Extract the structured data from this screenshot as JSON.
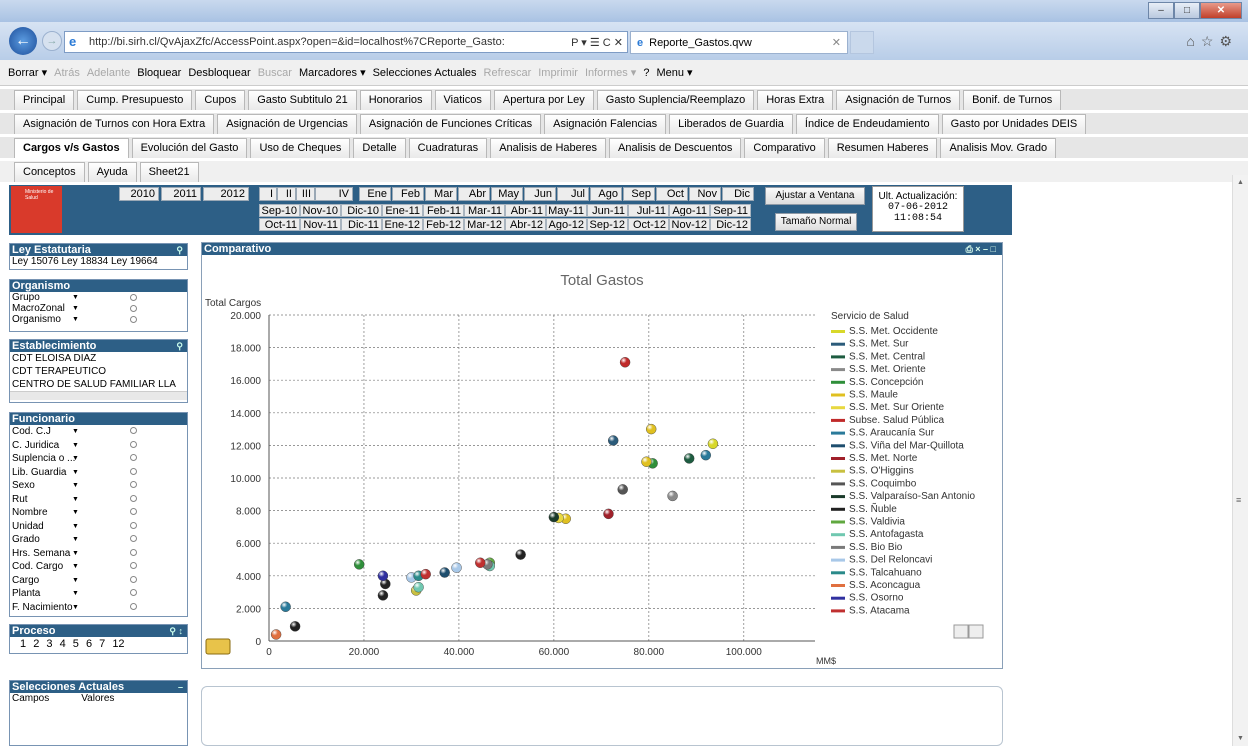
{
  "browser": {
    "url": "http://bi.sirh.cl/QvAjaxZfc/AccessPoint.aspx?open=&id=localhost%7CReporte_Gasto:",
    "url_controls": "Ρ ▾ ☰ C ✕",
    "tab_title": "Reporte_Gastos.qvw",
    "tab_close": "✕"
  },
  "qv_toolbar": [
    "Borrar ▾",
    "Atrás",
    "Adelante",
    "Bloquear",
    "Desbloquear",
    "Buscar",
    "Marcadores ▾",
    "Selecciones Actuales",
    "Refrescar",
    "Imprimir",
    "Informes ▾",
    "?",
    "Menu ▾"
  ],
  "tabs_row1": [
    "Principal",
    "Cump. Presupuesto",
    "Cupos",
    "Gasto Subtitulo 21",
    "Honorarios",
    "Viaticos",
    "Apertura por Ley",
    "Gasto Suplencia/Reemplazo",
    "Horas Extra",
    "Asignación de Turnos",
    "Bonif. de Turnos"
  ],
  "tabs_row2": [
    "Asignación de Turnos con Hora Extra",
    "Asignación de Urgencias",
    "Asignación de Funciones Críticas",
    "Asignación Falencias",
    "Liberados de Guardia",
    "Índice de Endeudamiento",
    "Gasto por Unidades DEIS"
  ],
  "tabs_row3": [
    "Cargos v/s Gastos",
    "Evolución del Gasto",
    "Uso de Cheques",
    "Detalle",
    "Cuadraturas",
    "Analisis de Haberes",
    "Analisis de Descuentos",
    "Comparativo",
    "Resumen Haberes",
    "Analisis Mov. Grado"
  ],
  "tabs_row4": [
    "Conceptos",
    "Ayuda",
    "Sheet21"
  ],
  "header": {
    "logo_text": "Ministerio de Salud",
    "years": [
      "2010",
      "2011",
      "2012"
    ],
    "quarters": [
      "I",
      "II",
      "III",
      "IV"
    ],
    "months": [
      "Ene",
      "Feb",
      "Mar",
      "Abr",
      "May",
      "Jun",
      "Jul",
      "Ago",
      "Sep",
      "Oct",
      "Nov",
      "Dic"
    ],
    "ym_row1": [
      "Sep-10",
      "Nov-10",
      "Dic-10",
      "Ene-11",
      "Feb-11",
      "Mar-11",
      "Abr-11",
      "May-11",
      "Jun-11",
      "Jul-11",
      "Ago-11",
      "Sep-11"
    ],
    "ym_row2": [
      "Oct-11",
      "Nov-11",
      "Dic-11",
      "Ene-12",
      "Feb-12",
      "Mar-12",
      "Abr-12",
      "Ago-12",
      "Sep-12",
      "Oct-12",
      "Nov-12",
      "Dic-12"
    ],
    "btn_ajustar": "Ajustar a Ventana",
    "btn_normal": "Tamaño Normal",
    "ult_label": "Ult. Actualización:",
    "ult_date": "07-06-2012",
    "ult_time": "11:08:54"
  },
  "ley": {
    "title": "Ley Estatutaria",
    "values": [
      "Ley 15076",
      "Ley 18834",
      "Ley 19664"
    ]
  },
  "organismo": {
    "title": "Organismo",
    "items": [
      "Grupo",
      "MacroZonal",
      "Organismo"
    ]
  },
  "establecimiento": {
    "title": "Establecimiento",
    "items": [
      "CDT ELOISA DIAZ",
      "CDT TERAPEUTICO",
      "CENTRO DE SALUD FAMILIAR LLA"
    ]
  },
  "funcionario": {
    "title": "Funcionario",
    "items": [
      "Cod. C.J",
      "C. Juridica",
      "Suplencia o ...",
      "Lib. Guardia",
      "Sexo",
      "Rut",
      "Nombre",
      "Unidad",
      "Grado",
      "Hrs. Semana",
      "Cod. Cargo",
      "Cargo",
      "Planta",
      "F. Nacimiento"
    ]
  },
  "proceso": {
    "title": "Proceso",
    "values": [
      "1",
      "2",
      "3",
      "4",
      "5",
      "6",
      "7",
      "12"
    ]
  },
  "selecciones": {
    "title": "Selecciones Actuales",
    "col1": "Campos",
    "col2": "Valores"
  },
  "chart_panel_title": "Comparativo",
  "chart_data": {
    "type": "scatter",
    "title": "Total Gastos",
    "ylabel": "Total Cargos",
    "xlabel": "MM$",
    "xlim": [
      0,
      115000
    ],
    "ylim": [
      0,
      20000
    ],
    "xticks": [
      "0",
      "20.000",
      "40.000",
      "60.000",
      "80.000",
      "100.000"
    ],
    "xtick_values": [
      0,
      20000,
      40000,
      60000,
      80000,
      100000
    ],
    "yticks": [
      "0",
      "2.000",
      "4.000",
      "6.000",
      "8.000",
      "10.000",
      "12.000",
      "14.000",
      "16.000",
      "18.000",
      "20.000"
    ],
    "ytick_values": [
      0,
      2000,
      4000,
      6000,
      8000,
      10000,
      12000,
      14000,
      16000,
      18000,
      20000
    ],
    "legend_title": "Servicio de Salud",
    "legend_position": "right",
    "series": [
      {
        "name": "S.S. Met. Occidente",
        "color": "#d8d82a",
        "points": [
          [
            93500,
            12100
          ]
        ]
      },
      {
        "name": "S.S. Met. Sur",
        "color": "#2b5b7a",
        "points": [
          [
            72500,
            12300
          ]
        ]
      },
      {
        "name": "S.S. Met. Central",
        "color": "#1d5c40",
        "points": [
          [
            88500,
            11200
          ]
        ]
      },
      {
        "name": "S.S. Met. Oriente",
        "color": "#8a8a8a",
        "points": [
          [
            85000,
            8900
          ]
        ]
      },
      {
        "name": "S.S. Concepción",
        "color": "#2f8f3a",
        "points": [
          [
            80800,
            10900
          ],
          [
            19000,
            4700
          ]
        ]
      },
      {
        "name": "S.S. Maule",
        "color": "#e0c020",
        "points": [
          [
            80500,
            13000
          ],
          [
            79500,
            11000
          ],
          [
            62500,
            7500
          ]
        ]
      },
      {
        "name": "S.S. Met. Sur Oriente",
        "color": "#e8d840",
        "points": [
          [
            61000,
            7550
          ]
        ]
      },
      {
        "name": "Subse. Salud Pública",
        "color": "#c02a2a",
        "points": [
          [
            75000,
            17100
          ]
        ]
      },
      {
        "name": "S.S. Araucanía Sur",
        "color": "#2a7a9a",
        "points": [
          [
            92000,
            11400
          ],
          [
            3500,
            2100
          ]
        ]
      },
      {
        "name": "S.S. Viña del Mar-Quillota",
        "color": "#1e4e6e",
        "points": [
          [
            37000,
            4200
          ]
        ]
      },
      {
        "name": "S.S. Met. Norte",
        "color": "#a0202a",
        "points": [
          [
            71500,
            7800
          ]
        ]
      },
      {
        "name": "S.S. O'Higgins",
        "color": "#c8c040",
        "points": [
          [
            31000,
            3100
          ]
        ]
      },
      {
        "name": "S.S. Coquimbo",
        "color": "#555555",
        "points": [
          [
            74500,
            9300
          ]
        ]
      },
      {
        "name": "S.S. Valparaíso-San Antonio",
        "color": "#1a3a2a",
        "points": [
          [
            60000,
            7600
          ]
        ]
      },
      {
        "name": "S.S. Ñuble",
        "color": "#222222",
        "points": [
          [
            53000,
            5300
          ],
          [
            24000,
            2800
          ],
          [
            24500,
            3500
          ],
          [
            5500,
            900
          ]
        ]
      },
      {
        "name": "S.S. Valdivia",
        "color": "#60a840",
        "points": [
          [
            46500,
            4800
          ]
        ]
      },
      {
        "name": "S.S. Antofagasta",
        "color": "#70c8b0",
        "points": [
          [
            46500,
            4600
          ],
          [
            31500,
            3300
          ]
        ]
      },
      {
        "name": "S.S. Bio Bio",
        "color": "#7a7a7a",
        "points": [
          [
            46000,
            4700
          ]
        ]
      },
      {
        "name": "S.S. Del Reloncavi",
        "color": "#a8c8e8",
        "points": [
          [
            39500,
            4500
          ],
          [
            30000,
            3900
          ]
        ]
      },
      {
        "name": "S.S. Talcahuano",
        "color": "#2a8a8a",
        "points": [
          [
            31500,
            4000
          ]
        ]
      },
      {
        "name": "S.S. Aconcagua",
        "color": "#e07040",
        "points": [
          [
            1500,
            400
          ]
        ]
      },
      {
        "name": "S.S. Osorno",
        "color": "#3030a0",
        "points": [
          [
            24000,
            4000
          ]
        ]
      },
      {
        "name": "S.S. Atacama",
        "color": "#c03030",
        "points": [
          [
            44500,
            4800
          ],
          [
            33000,
            4100
          ]
        ]
      }
    ]
  }
}
